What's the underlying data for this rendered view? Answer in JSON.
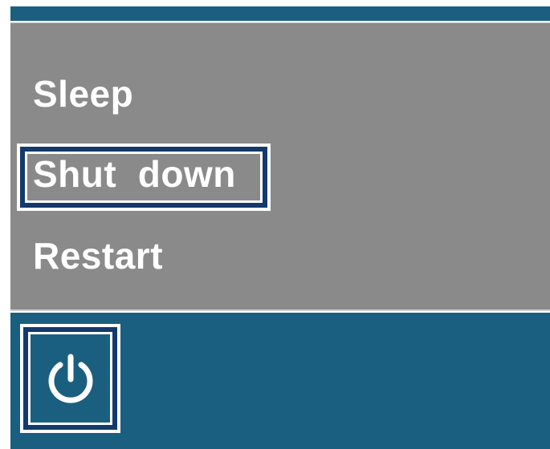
{
  "menu": {
    "items": [
      {
        "label": "Sleep"
      },
      {
        "label": "Shut  down",
        "focused": true
      },
      {
        "label": "Restart"
      }
    ]
  },
  "power_button": {
    "icon": "power-icon"
  },
  "colors": {
    "menu_background": "#8a8a8a",
    "bar_background": "#1b5f80",
    "focus_ring": "#143a6c",
    "text": "#ffffff"
  }
}
